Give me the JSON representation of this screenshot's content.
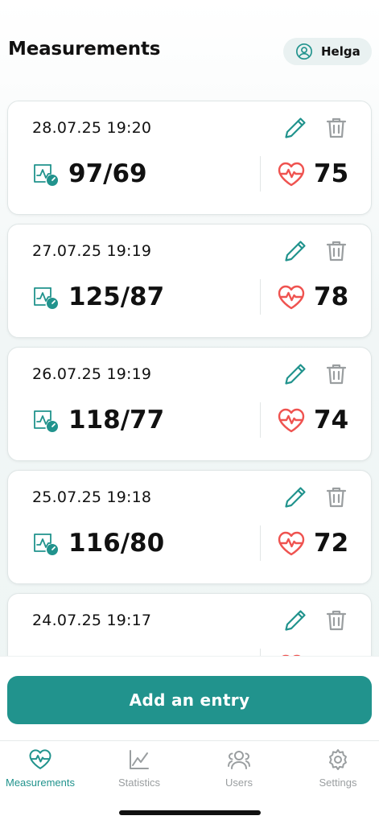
{
  "header": {
    "title": "Measurements",
    "user_name": "Helga"
  },
  "measurements": [
    {
      "date": "28.07.25 19:20",
      "bp": "97/69",
      "pulse": "75"
    },
    {
      "date": "27.07.25 19:19",
      "bp": "125/87",
      "pulse": "78"
    },
    {
      "date": "26.07.25 19:19",
      "bp": "118/77",
      "pulse": "74"
    },
    {
      "date": "25.07.25 19:18",
      "bp": "116/80",
      "pulse": "72"
    },
    {
      "date": "24.07.25 19:17",
      "bp": "",
      "pulse": ""
    }
  ],
  "actions": {
    "add_entry": "Add an entry"
  },
  "tabs": [
    {
      "label": "Measurements",
      "icon": "heart-pulse-icon",
      "active": true
    },
    {
      "label": "Statistics",
      "icon": "chart-line-icon",
      "active": false
    },
    {
      "label": "Users",
      "icon": "users-icon",
      "active": false
    },
    {
      "label": "Settings",
      "icon": "gear-icon",
      "active": false
    }
  ],
  "colors": {
    "accent": "#21938d",
    "heart": "#ef5350",
    "inactive": "#9a9ea0"
  }
}
